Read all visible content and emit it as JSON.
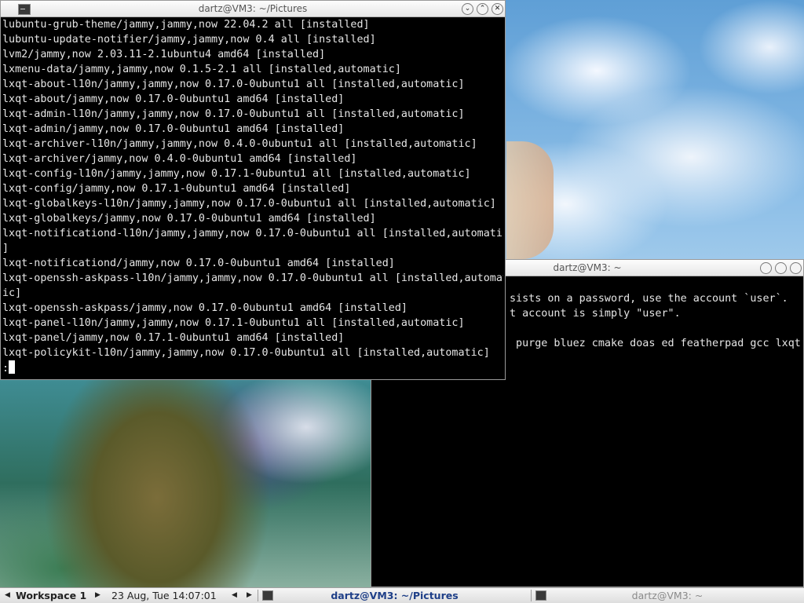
{
  "terminal_main": {
    "title": "dartz@VM3: ~/Pictures",
    "lines": [
      "lubuntu-grub-theme/jammy,jammy,now 22.04.2 all [installed]",
      "lubuntu-update-notifier/jammy,jammy,now 0.4 all [installed]",
      "lvm2/jammy,now 2.03.11-2.1ubuntu4 amd64 [installed]",
      "lxmenu-data/jammy,jammy,now 0.1.5-2.1 all [installed,automatic]",
      "lxqt-about-l10n/jammy,jammy,now 0.17.0-0ubuntu1 all [installed,automatic]",
      "lxqt-about/jammy,now 0.17.0-0ubuntu1 amd64 [installed]",
      "lxqt-admin-l10n/jammy,jammy,now 0.17.0-0ubuntu1 all [installed,automatic]",
      "lxqt-admin/jammy,now 0.17.0-0ubuntu1 amd64 [installed]",
      "lxqt-archiver-l10n/jammy,jammy,now 0.4.0-0ubuntu1 all [installed,automatic]",
      "lxqt-archiver/jammy,now 0.4.0-0ubuntu1 amd64 [installed]",
      "lxqt-config-l10n/jammy,jammy,now 0.17.1-0ubuntu1 all [installed,automatic]",
      "lxqt-config/jammy,now 0.17.1-0ubuntu1 amd64 [installed]",
      "lxqt-globalkeys-l10n/jammy,jammy,now 0.17.0-0ubuntu1 all [installed,automatic]",
      "lxqt-globalkeys/jammy,now 0.17.0-0ubuntu1 amd64 [installed]",
      "lxqt-notificationd-l10n/jammy,jammy,now 0.17.0-0ubuntu1 all [installed,automatic",
      "]",
      "lxqt-notificationd/jammy,now 0.17.0-0ubuntu1 amd64 [installed]",
      "lxqt-openssh-askpass-l10n/jammy,jammy,now 0.17.0-0ubuntu1 all [installed,automat",
      "ic]",
      "lxqt-openssh-askpass/jammy,now 0.17.0-0ubuntu1 amd64 [installed]",
      "lxqt-panel-l10n/jammy,jammy,now 0.17.1-0ubuntu1 all [installed,automatic]",
      "lxqt-panel/jammy,now 0.17.1-0ubuntu1 amd64 [installed]",
      "lxqt-policykit-l10n/jammy,jammy,now 0.17.0-0ubuntu1 all [installed,automatic]"
    ],
    "prompt": ":"
  },
  "terminal_back": {
    "title": "dartz@VM3: ~",
    "lines": [
      "",
      "sists on a password, use the account `user`.",
      "t account is simply \"user\".",
      "",
      " purge bluez cmake doas ed featherpad gcc lxqt-"
    ]
  },
  "taskbar": {
    "workspace": "Workspace 1",
    "clock": "23 Aug, Tue 14:07:01",
    "tasks": [
      {
        "label": "dartz@VM3: ~/Pictures",
        "active": true
      },
      {
        "label": "dartz@VM3: ~",
        "active": false
      }
    ]
  },
  "colors": {
    "terminal_bg": "#000000",
    "terminal_fg": "#e6e6e6",
    "titlebar_bg": "#f0f0f0",
    "active_task_text": "#1e3f88"
  }
}
